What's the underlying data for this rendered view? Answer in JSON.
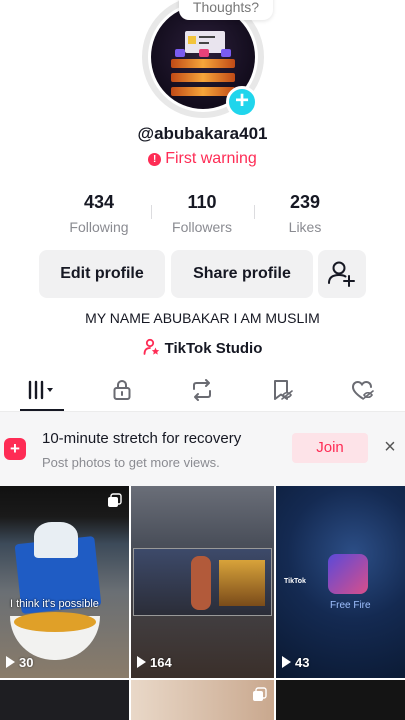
{
  "avatar": {
    "bubble_text": "Thoughts?",
    "add_badge": "+"
  },
  "profile": {
    "username": "@abubakara401",
    "warning_icon": "!",
    "warning": "First warning",
    "bio": "MY NAME ABUBAKAR I AM MUSLIM",
    "studio_label": "TikTok Studio"
  },
  "stats": {
    "following": {
      "value": "434",
      "label": "Following"
    },
    "followers": {
      "value": "110",
      "label": "Followers"
    },
    "likes": {
      "value": "239",
      "label": "Likes"
    }
  },
  "buttons": {
    "edit": "Edit profile",
    "share": "Share profile"
  },
  "tabs": [
    "videos-grid-icon",
    "lock-icon",
    "repost-icon",
    "favorites-icon",
    "liked-icon"
  ],
  "banner": {
    "title": "10-minute stretch for recovery",
    "subtitle": "Post photos to get more views.",
    "join": "Join",
    "close": "×"
  },
  "videos": [
    {
      "views": "30",
      "caption": "I think it's possible"
    },
    {
      "views": "164"
    },
    {
      "views": "43",
      "caption": "Free Fire",
      "brand": "TikTok"
    }
  ],
  "colors": {
    "accent": "#fe2c55",
    "badge": "#20d5ec"
  }
}
